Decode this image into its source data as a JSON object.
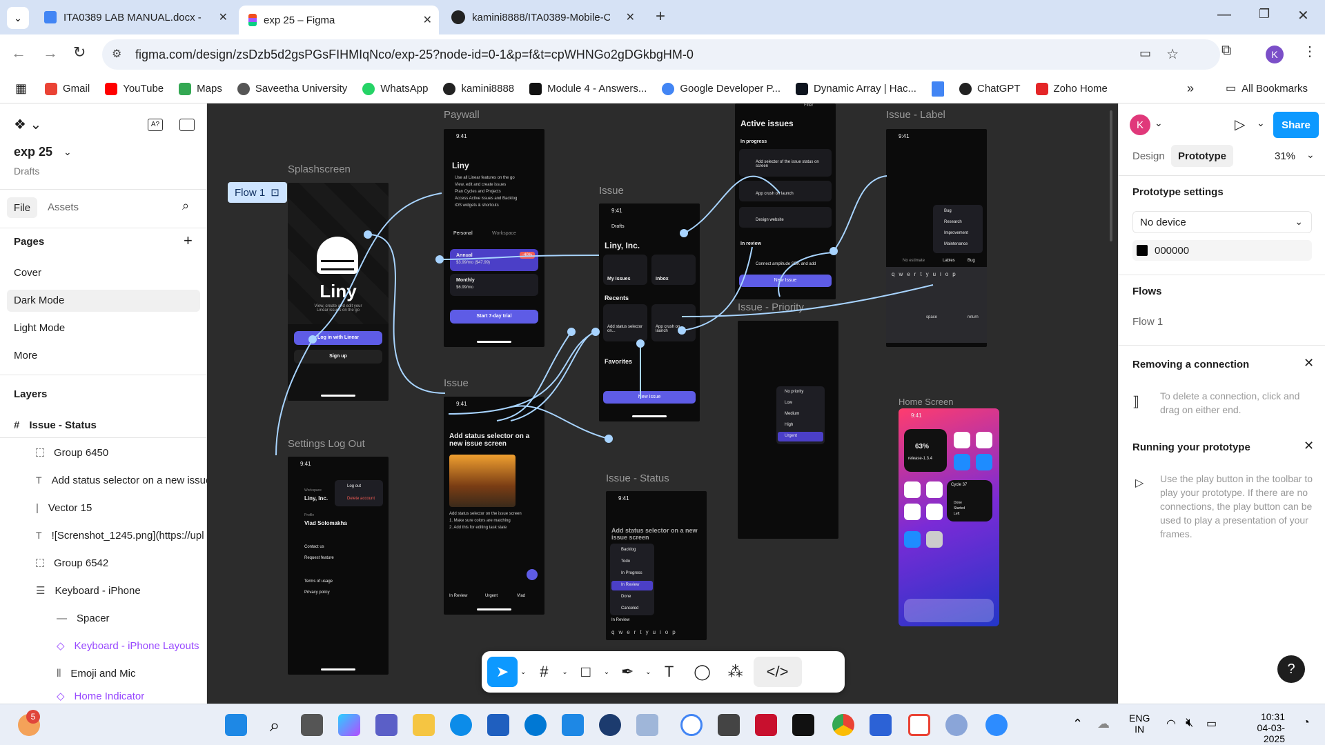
{
  "browser": {
    "tabs": [
      {
        "title": "ITA0389 LAB MANUAL.docx - G",
        "active": false
      },
      {
        "title": "exp 25 – Figma",
        "active": true
      },
      {
        "title": "kamini8888/ITA0389-Mobile-C",
        "active": false
      }
    ],
    "url": "figma.com/design/zsDzb5d2gsPGsFIHMIqNco/exp-25?node-id=0-1&p=f&t=cpWHNGo2gDGkbgHM-0",
    "profile_initial": "K",
    "bookmarks": [
      "Gmail",
      "YouTube",
      "Maps",
      "Saveetha University",
      "WhatsApp",
      "kamini8888",
      "Module 4 - Answers...",
      "Google Developer P...",
      "Dynamic Array | Hac...",
      "ChatGPT",
      "Zoho Home"
    ],
    "all_bookmarks": "All Bookmarks"
  },
  "figma": {
    "file_name": "exp 25",
    "file_location": "Drafts",
    "tabs": {
      "file": "File",
      "assets": "Assets"
    },
    "pages_title": "Pages",
    "pages": [
      "Cover",
      "Dark Mode",
      "Light Mode",
      "More"
    ],
    "selected_page": "Dark Mode",
    "layers_title": "Layers",
    "layers": [
      {
        "name": "Issue - Status",
        "icon": "frame-icon",
        "indent": 0
      },
      {
        "name": "Group 6450",
        "icon": "group-icon",
        "indent": 1
      },
      {
        "name": "Add status selector on a new issue screen",
        "icon": "text-icon",
        "indent": 1
      },
      {
        "name": "Vector 15",
        "icon": "vector-icon",
        "indent": 1
      },
      {
        "name": "![Screnshot_1245.png](https://upl",
        "icon": "text-icon",
        "indent": 1
      },
      {
        "name": "Group 6542",
        "icon": "group-icon",
        "indent": 1
      },
      {
        "name": "Keyboard - iPhone",
        "icon": "component-stack-icon",
        "indent": 1
      },
      {
        "name": "Spacer",
        "icon": "line-icon",
        "indent": 2
      },
      {
        "name": "Keyboard - iPhone Layouts",
        "icon": "component-instance-icon",
        "indent": 2
      },
      {
        "name": "Emoji and Mic",
        "icon": "autolayout-icon",
        "indent": 2
      },
      {
        "name": "Home Indicator",
        "icon": "component-instance-icon",
        "indent": 2
      }
    ],
    "flow_badge": "Flow 1",
    "frames": {
      "splash": "Splashscreen",
      "paywall": "Paywall",
      "issue_top": "Issue",
      "issue_mid": "Issue",
      "issue_status": "Issue - Status",
      "issue_label": "Issue - Label",
      "issue_priority": "Issue - Priority",
      "settings": "Settings Log Out",
      "home": "Home Screen"
    },
    "screen_text": {
      "time": "9:41",
      "liny": "Liny",
      "liny_sub": "View, create and edit your Linear issues on the go",
      "login_btn": "Log in with Linear",
      "signup_btn": "Sign up",
      "paywall_title": "Liny",
      "paywall_features": [
        "Use all Linear features on the go",
        "View, edit and create issues",
        "Plan Cycles and Projects",
        "Access Active issues and Backlog",
        "iOS widgets & shortcuts"
      ],
      "personal": "Personal",
      "workspace": "Workspace",
      "annual": "Annual",
      "annual_price": "$3.99/mo ($47.99)",
      "discount": "-40%",
      "monthly": "Monthly",
      "monthly_price": "$6.99/mo",
      "trial_btn": "Start 7-day trial",
      "drafts": "Drafts",
      "company": "Liny, Inc.",
      "my_issues": "My Issues",
      "inbox": "Inbox",
      "recents": "Recents",
      "recent_1": "Add status selector on...",
      "recent_2": "App crush on launch",
      "favorites": "Favorites",
      "new_issue": "New Issue",
      "active_issues": "Active issues",
      "in_progress": "In progress",
      "active_1": "Add selector of the issue status on screen",
      "active_2": "App crush on launch",
      "active_3": "Design website",
      "in_review": "In review",
      "review_1": "Connect amplitude SDK and add",
      "filter": "Filter",
      "issue_title": "Add status selector on a new issue screen",
      "issue_desc": [
        "Add status selector on the issue screen",
        "1. Make sure colors are matching",
        "2. Add this for editing task state"
      ],
      "tag_review": "In Review",
      "tag_urgent": "Urgent",
      "tag_user": "Vlad",
      "status_options": [
        "Backlog",
        "Todo",
        "In Progress",
        "In Review",
        "Done",
        "Canceled"
      ],
      "label_options": [
        "Bug",
        "Research",
        "Improvement",
        "Maintenance"
      ],
      "label_chips": [
        "No estimate",
        "Lables",
        "Bug"
      ],
      "priority_options": [
        "No priority",
        "Low",
        "Medium",
        "High",
        "Urgent"
      ],
      "log_out": "Log out",
      "delete_account": "Delete account",
      "workspace_label": "Workspace",
      "profile_label": "Profile",
      "profile_name": "Vlad Solomakha",
      "contact_us": "Contact us",
      "request_feature": "Request feature",
      "terms": "Terms of usage",
      "privacy": "Privacy policy",
      "widget_pct": "63%",
      "widget_release": "release-1.3.4",
      "widget_cycle": "Cycle 37",
      "widget_cycle_items": [
        "Done",
        "Started",
        "Left"
      ],
      "keyboard_row": "qwertyuiop",
      "space": "space",
      "return": "return"
    },
    "right": {
      "avatar": "K",
      "tabs": [
        "Design",
        "Prototype"
      ],
      "active_tab": "Prototype",
      "zoom": "31%",
      "share": "Share",
      "prototype_settings": "Prototype settings",
      "device": "No device",
      "bg_color": "000000",
      "flows": "Flows",
      "flow_item": "Flow 1",
      "removing_title": "Removing a connection",
      "removing_text": "To delete a connection, click and drag on either end.",
      "running_title": "Running your prototype",
      "running_text": "Use the play button in the toolbar to play your prototype. If there are no connections, the play button can be used to play a presentation of your frames.",
      "help": "?"
    }
  },
  "taskbar": {
    "notifications": "5",
    "lang": "ENG",
    "region": "IN",
    "time": "10:31",
    "date": "04-03-2025"
  }
}
